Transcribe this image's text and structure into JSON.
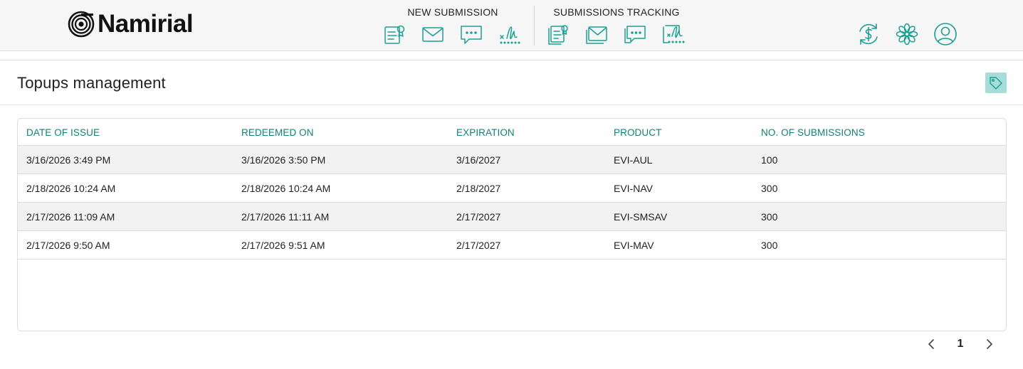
{
  "brand": {
    "name": "Namirial"
  },
  "nav": {
    "new_submission": {
      "title": "NEW SUBMISSION",
      "icons": [
        "document-icon",
        "mail-icon",
        "chat-icon",
        "signature-icon"
      ]
    },
    "submissions_tracking": {
      "title": "SUBMISSIONS TRACKING",
      "icons": [
        "document-stack-icon",
        "mail-stack-icon",
        "chat-stack-icon",
        "signature-stack-icon"
      ]
    },
    "right_icons": [
      "refresh-dollar-icon",
      "flower-icon",
      "user-icon"
    ]
  },
  "page": {
    "title": "Topups management"
  },
  "colors": {
    "accent": "#1a9f93",
    "header_text": "#127f78",
    "tag_bg": "#a6ddd7"
  },
  "table": {
    "columns": [
      "DATE OF ISSUE",
      "REDEEMED ON",
      "EXPIRATION",
      "PRODUCT",
      "NO. OF SUBMISSIONS"
    ],
    "rows": [
      [
        "3/16/2026 3:49 PM",
        "3/16/2026 3:50 PM",
        "3/16/2027",
        "EVI-AUL",
        "100"
      ],
      [
        "2/18/2026 10:24 AM",
        "2/18/2026 10:24 AM",
        "2/18/2027",
        "EVI-NAV",
        "300"
      ],
      [
        "2/17/2026 11:09 AM",
        "2/17/2026 11:11 AM",
        "2/17/2027",
        "EVI-SMSAV",
        "300"
      ],
      [
        "2/17/2026 9:50 AM",
        "2/17/2026 9:51 AM",
        "2/17/2027",
        "EVI-MAV",
        "300"
      ]
    ]
  },
  "pagination": {
    "current_page": "1"
  }
}
